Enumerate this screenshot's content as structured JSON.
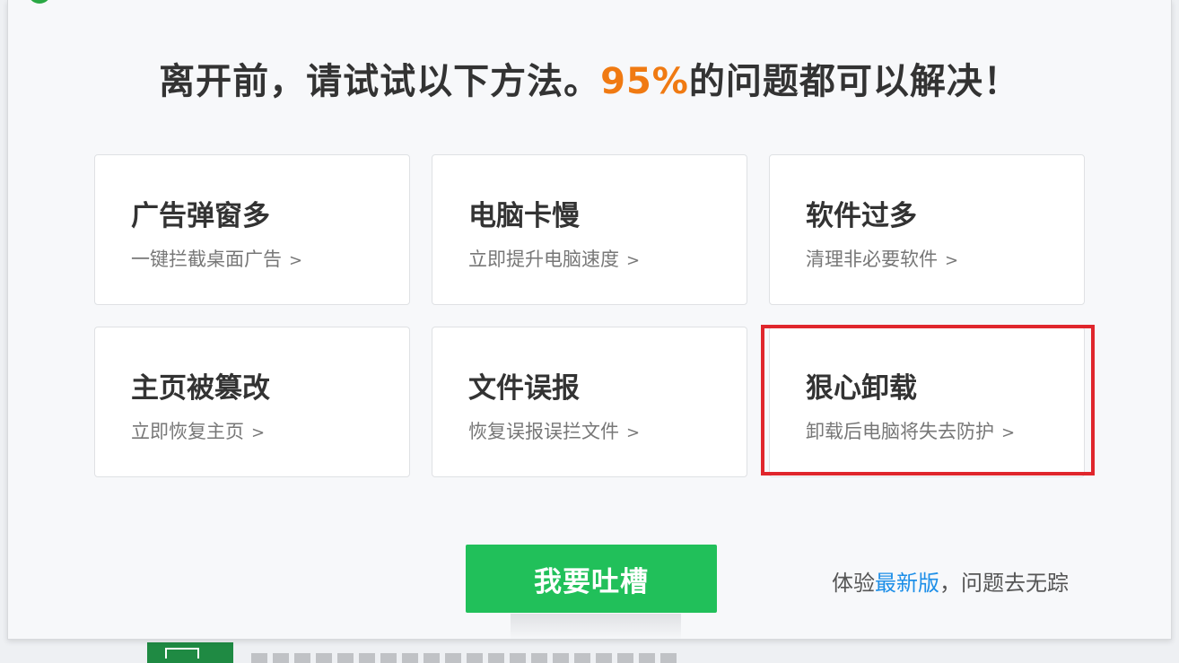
{
  "headline": {
    "before": "离开前，请试试以下方法。",
    "percent": "95%",
    "after": "的问题都可以解决！"
  },
  "cards": [
    {
      "title": "广告弹窗多",
      "desc": "一键拦截桌面广告"
    },
    {
      "title": "电脑卡慢",
      "desc": "立即提升电脑速度"
    },
    {
      "title": "软件过多",
      "desc": "清理非必要软件"
    },
    {
      "title": "主页被篡改",
      "desc": "立即恢复主页"
    },
    {
      "title": "文件误报",
      "desc": "恢复误报误拦文件"
    },
    {
      "title": "狠心卸载",
      "desc": "卸载后电脑将失去防护"
    }
  ],
  "chevron": ">",
  "complain_button": "我要吐槽",
  "promo": {
    "prefix": "体验",
    "link": "最新版",
    "suffix": "，问题去无踪"
  },
  "colors": {
    "accent_orange": "#f07a12",
    "button_green": "#21c05a",
    "link_blue": "#1e8fe8",
    "highlight_red": "#e0262c"
  }
}
